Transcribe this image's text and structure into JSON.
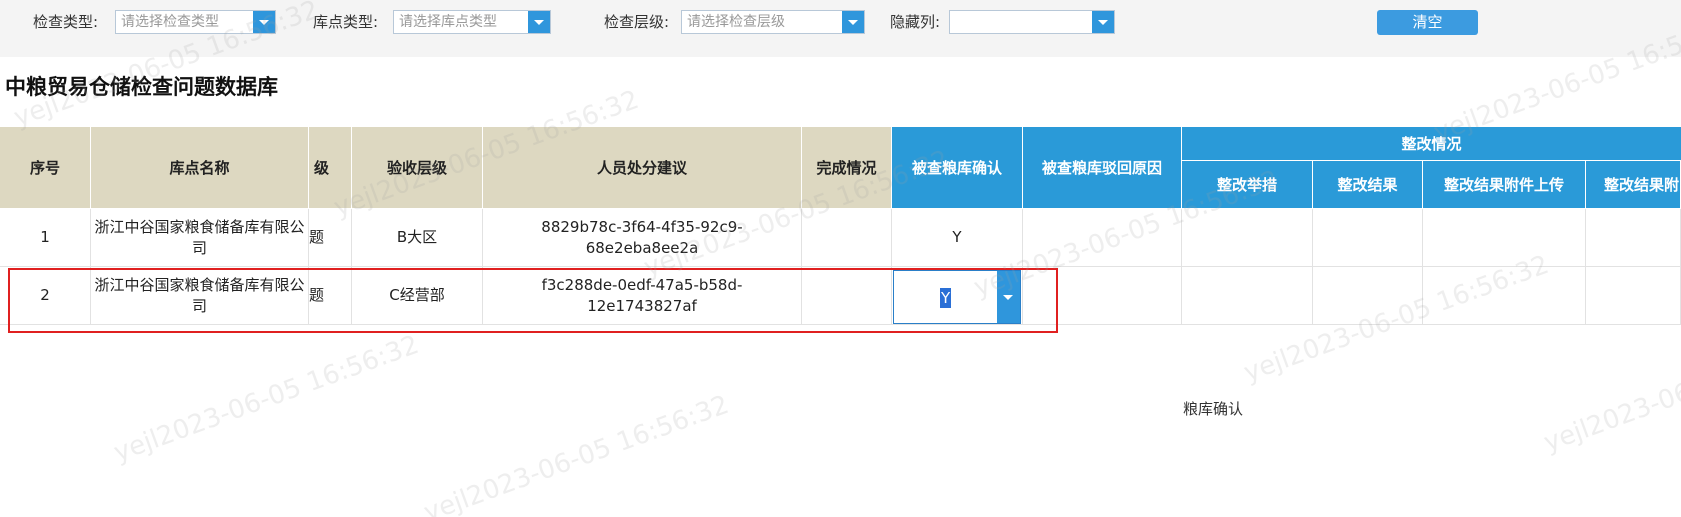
{
  "filters": {
    "inspection_type": {
      "label": "检查类型:",
      "placeholder": "请选择检查类型"
    },
    "depot_type": {
      "label": "库点类型:",
      "placeholder": "请选择库点类型"
    },
    "inspection_level": {
      "label": "检查层级:",
      "placeholder": "请选择检查层级"
    },
    "hidden_columns": {
      "label": "隐藏列:",
      "placeholder": ""
    },
    "clear_label": "清空"
  },
  "page_title": "中粮贸易仓储检查问题数据库",
  "table": {
    "headers": {
      "seq": "序号",
      "depot_name": "库点名称",
      "level_partial": "级",
      "acceptance_level": "验收层级",
      "disposal_suggestion": "人员处分建议",
      "completion": "完成情况",
      "depot_confirm": "被查粮库确认",
      "reject_reason": "被查粮库驳回原因",
      "rectification_group": "整改情况",
      "rect_measures": "整改举措",
      "rect_result": "整改结果",
      "rect_attachment_upload": "整改结果附件上传",
      "rect_result_partial": "整改结果附"
    },
    "rows": [
      {
        "seq": "1",
        "depot_name": "浙江中谷国家粮食储备库有限公司",
        "issue_partial": "题",
        "acceptance_level": "B大区",
        "disposal_suggestion": "8829b78c-3f64-4f35-92c9-68e2eba8ee2a",
        "completion": "",
        "depot_confirm": "Y"
      },
      {
        "seq": "2",
        "depot_name": "浙江中谷国家粮食储备库有限公司",
        "issue_partial": "题",
        "acceptance_level": "C经营部",
        "disposal_suggestion": "f3c288de-0edf-47a5-b58d-12e1743827af",
        "completion": "",
        "depot_confirm": "Y"
      }
    ]
  },
  "footer_label": "粮库确认",
  "watermark_text": "yejl2023-06-05 16:56:32",
  "colors": {
    "header_beige": "#ddd8c1",
    "header_blue": "#2a9ad8",
    "accent_button": "#3c9be0",
    "highlight_border": "#e02020"
  }
}
